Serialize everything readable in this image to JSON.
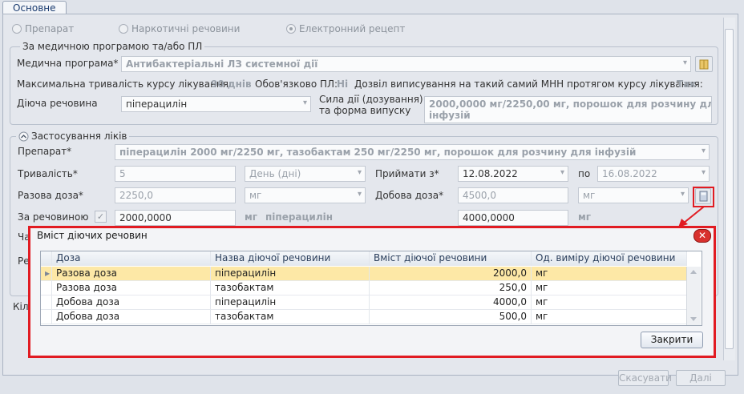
{
  "tabs": [
    {
      "label": "Основне"
    }
  ],
  "source_type": {
    "options": [
      "Препарат",
      "Наркотичні речовини",
      "Електронний рецепт"
    ],
    "selected": "Електронний рецепт"
  },
  "program": {
    "group_title": "За медичною програмою та/або ПЛ",
    "program_label": "Медична програма*",
    "program_value": "Антибактеріальні ЛЗ системної дії",
    "max_duration_label": "Максимальна тривалість курсу лікування",
    "max_duration_value": "90 днів",
    "required_label": "Обов'язково ПЛ:",
    "required_value": "Ні",
    "allow_label": "Дозвіл виписування на такий самий МНН протягом курсу лікування:",
    "allow_value": "Так",
    "substance_label": "Діюча речовина",
    "substance_value": "піперацилін",
    "strength_label_1": "Сила дії (дозування)",
    "strength_label_2": "та форма випуску",
    "strength_value_1": "2000,0000 мг/2250,00 мг, порошок для розчину для",
    "strength_value_2": "інфузій"
  },
  "usage": {
    "group_title": "Застосування ліків",
    "drug_label": "Препарат*",
    "drug_value": "піперацилін 2000 мг/2250 мг, тазобактам 250 мг/2250 мг, порошок для розчину для інфузій",
    "duration_label": "Тривалість*",
    "duration_value": "5",
    "duration_unit": "День (дні)",
    "take_from_label": "Приймати з*",
    "take_from_value": "12.08.2022",
    "to_label": "по",
    "to_value": "16.08.2022",
    "single_dose_label": "Разова доза*",
    "single_dose_value": "2250,0",
    "single_dose_unit": "мг",
    "daily_dose_label": "Добова доза*",
    "daily_dose_value": "4500,0",
    "daily_dose_unit": "мг",
    "by_substance_label": "За речовиною",
    "by_substance_value": "2000,0000",
    "by_substance_unit": "мг",
    "by_substance_name": "піперацилін",
    "daily_by_substance_value": "4000,0000",
    "daily_by_substance_unit": "мг",
    "hidden_label_1": "Ча",
    "hidden_label_2": "Ре"
  },
  "quantity_label_partial": "Кіл",
  "footer": {
    "cancel_label": "Скасувати",
    "next_label": "Далі"
  },
  "dialog": {
    "title": "Вміст діючих речовин",
    "columns": [
      "Доза",
      "Назва діючої речовини",
      "Вміст діючої речовини",
      "Од. виміру діючої речовини"
    ],
    "rows": [
      {
        "dose": "Разова доза",
        "substance": "піперацилін",
        "amount": "2000,0",
        "unit": "мг"
      },
      {
        "dose": "Разова доза",
        "substance": "тазобактам",
        "amount": "250,0",
        "unit": "мг"
      },
      {
        "dose": "Добова доза",
        "substance": "піперацилін",
        "amount": "4000,0",
        "unit": "мг"
      },
      {
        "dose": "Добова доза",
        "substance": "тазобактам",
        "amount": "500,0",
        "unit": "мг"
      }
    ],
    "close_label": "Закрити"
  },
  "colors": {
    "accent_red": "#e11b22",
    "selected_row": "#fde8a6",
    "title_blue": "#1b3c70"
  }
}
